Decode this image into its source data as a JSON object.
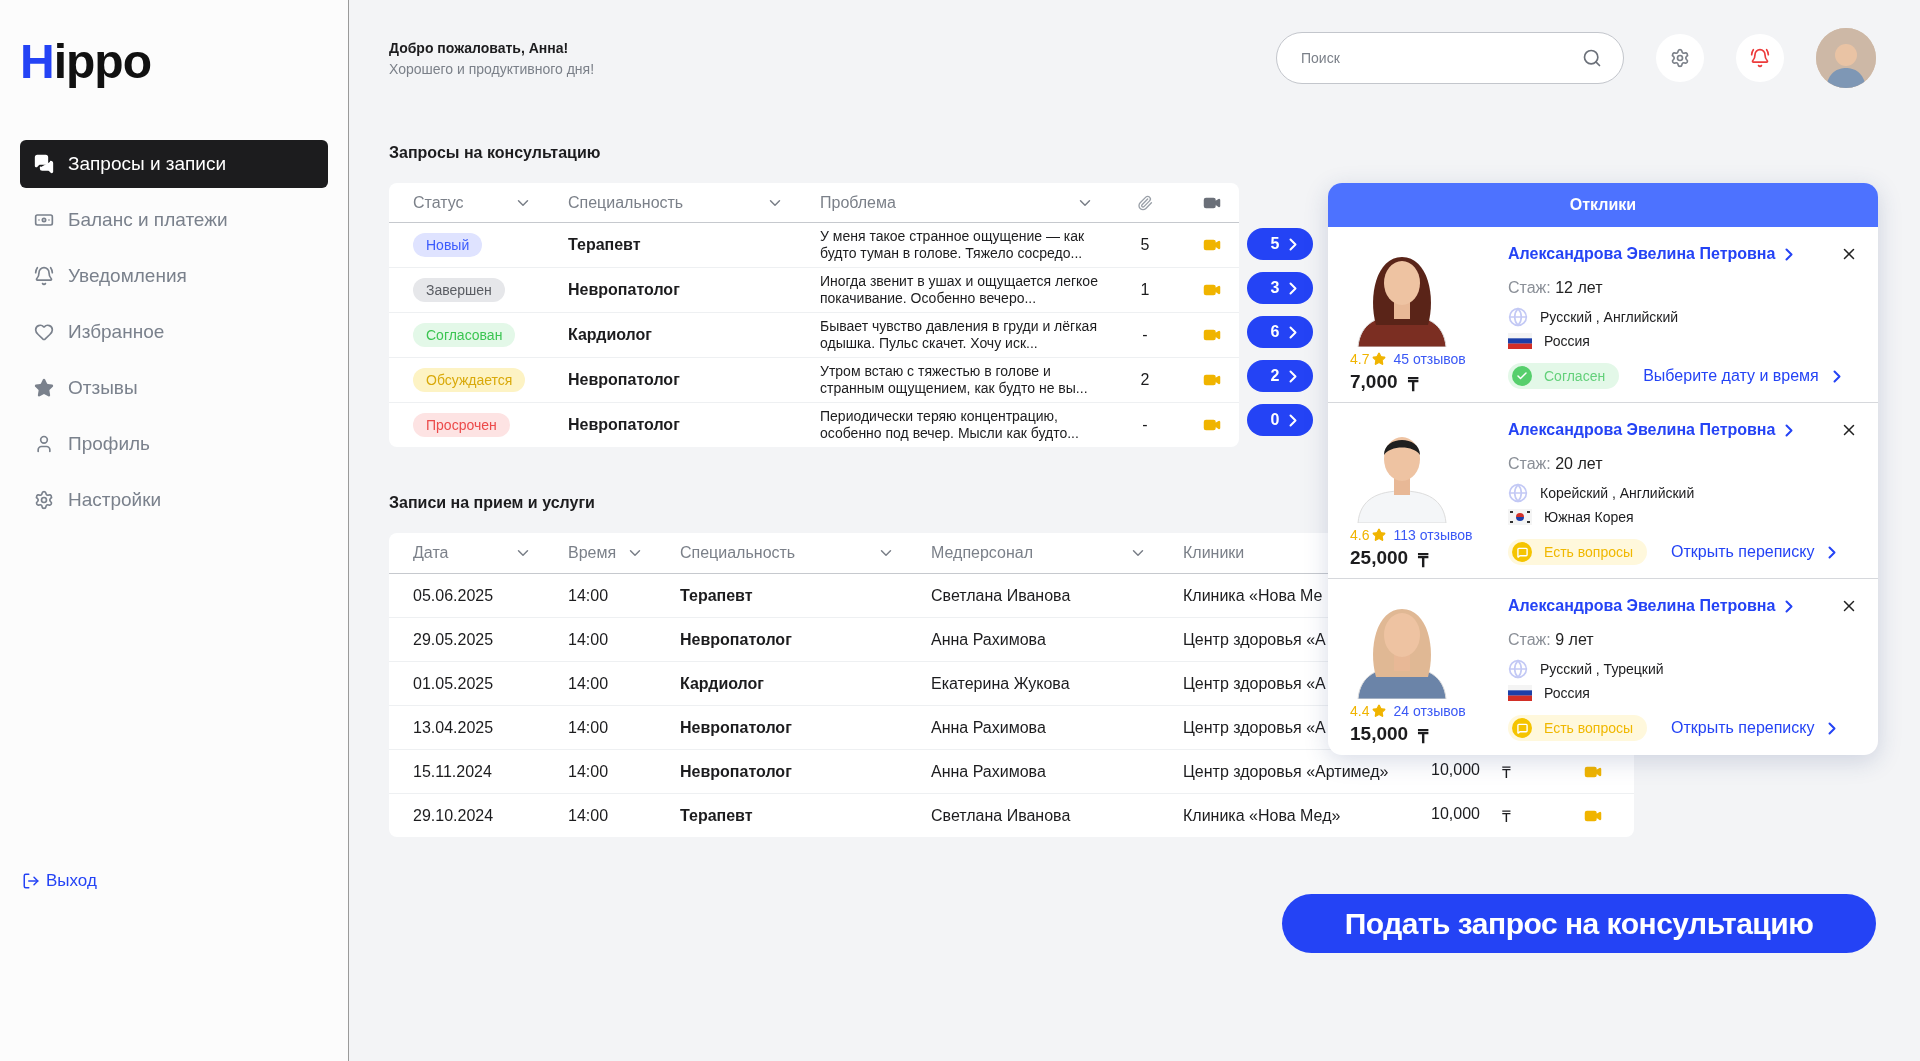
{
  "brand": {
    "name": "Hippo"
  },
  "sidebar": {
    "items": [
      {
        "label": "Запросы и записи",
        "selected": true
      },
      {
        "label": "Баланс и платежи",
        "selected": false
      },
      {
        "label": "Уведомления",
        "selected": false
      },
      {
        "label": "Избранное",
        "selected": false
      },
      {
        "label": "Отзывы",
        "selected": false
      },
      {
        "label": "Профиль",
        "selected": false
      },
      {
        "label": "Настройки",
        "selected": false
      }
    ],
    "logout": "Выход"
  },
  "header": {
    "greeting": "Добро пожаловать, Анна!",
    "subtitle": "Хорошего и продуктивного дня!",
    "search": {
      "placeholder": "Поиск"
    }
  },
  "requests": {
    "title": "Запросы на консультацию",
    "columns": [
      "Статус",
      "Специальность",
      "Проблема"
    ],
    "rows": [
      {
        "status": {
          "label": "Новый",
          "kind": "new"
        },
        "specialty": "Терапевт",
        "problem": "У меня такое странное ощущение — как будто туман в голове. Тяжело сосредо...",
        "files": "5",
        "responses": "5"
      },
      {
        "status": {
          "label": "Завершен",
          "kind": "done"
        },
        "specialty": "Невропатолог",
        "problem": "Иногда звенит в ушах и ощущается легкое покачивание. Особенно вечеро...",
        "files": "1",
        "responses": "3"
      },
      {
        "status": {
          "label": "Согласован",
          "kind": "agreed"
        },
        "specialty": "Кардиолог",
        "problem": "Бывает чувство давления в груди и лёгкая одышка. Пульс скачет. Хочу иск...",
        "files": "-",
        "responses": "6"
      },
      {
        "status": {
          "label": "Обсуждается",
          "kind": "discussed"
        },
        "specialty": "Невропатолог",
        "problem": "Утром встаю с тяжестью в голове и странным ощущением, как будто не вы...",
        "files": "2",
        "responses": "2"
      },
      {
        "status": {
          "label": "Просрочен",
          "kind": "overdue"
        },
        "specialty": "Невропатолог",
        "problem": "Периодически теряю концентрацию, особенно под вечер. Мысли как будто...",
        "files": "-",
        "responses": "0"
      }
    ]
  },
  "appointments": {
    "title": "Записи на прием и услуги",
    "columns": [
      "Дата",
      "Время",
      "Специальность",
      "Медперсонал",
      "Клиники"
    ],
    "rows": [
      {
        "date": "05.06.2025",
        "time": "14:00",
        "specialty": "Терапевт",
        "staff": "Светлана Иванова",
        "clinic": "Клиника «Нова Ме"
      },
      {
        "date": "29.05.2025",
        "time": "14:00",
        "specialty": "Невропатолог",
        "staff": "Анна Рахимова",
        "clinic": "Центр здоровья «А"
      },
      {
        "date": "01.05.2025",
        "time": "14:00",
        "specialty": "Кардиолог",
        "staff": "Екатерина Жукова",
        "clinic": "Центр здоровья «А"
      },
      {
        "date": "13.04.2025",
        "time": "14:00",
        "specialty": "Невропатолог",
        "staff": "Анна Рахимова",
        "clinic": "Центр здоровья «А"
      },
      {
        "date": "15.11.2024",
        "time": "14:00",
        "specialty": "Невропатолог",
        "staff": "Анна Рахимова",
        "clinic": "Центр здоровья «Артимед»",
        "price": "10,000",
        "currency": "₸"
      },
      {
        "date": "29.10.2024",
        "time": "14:00",
        "specialty": "Терапевт",
        "staff": "Светлана Иванова",
        "clinic": "Клиника «Нова Мед»",
        "price": "10,000",
        "currency": "₸"
      }
    ]
  },
  "responses": {
    "title": "Отклики",
    "cards": [
      {
        "name": "Александрова Эвелина Петровна",
        "experience_label": "Стаж:",
        "experience": "12 лет",
        "languages": "Русский , Английский",
        "country": "Россия",
        "rating": "4.7",
        "reviews": "45 отзывов",
        "price": "7,000",
        "currency": "₸",
        "status": {
          "label": "Согласен",
          "kind": "agreed"
        },
        "action": "Выберите дату и время"
      },
      {
        "name": "Александрова Эвелина Петровна",
        "experience_label": "Стаж:",
        "experience": "20 лет",
        "languages": "Корейский , Английский",
        "country": "Южная Корея",
        "rating": "4.6",
        "reviews": "113 отзывов",
        "price": "25,000",
        "currency": "₸",
        "status": {
          "label": "Есть вопросы",
          "kind": "questions"
        },
        "action": "Открыть переписку"
      },
      {
        "name": "Александрова Эвелина Петровна",
        "experience_label": "Стаж:",
        "experience": "9 лет",
        "languages": "Русский , Турецкий",
        "country": "Россия",
        "rating": "4.4",
        "reviews": "24 отзывов",
        "price": "15,000",
        "currency": "₸",
        "status": {
          "label": "Есть вопросы",
          "kind": "questions"
        },
        "action": "Открыть переписку"
      }
    ]
  },
  "submit_button": "Подать запрос на консультацию"
}
